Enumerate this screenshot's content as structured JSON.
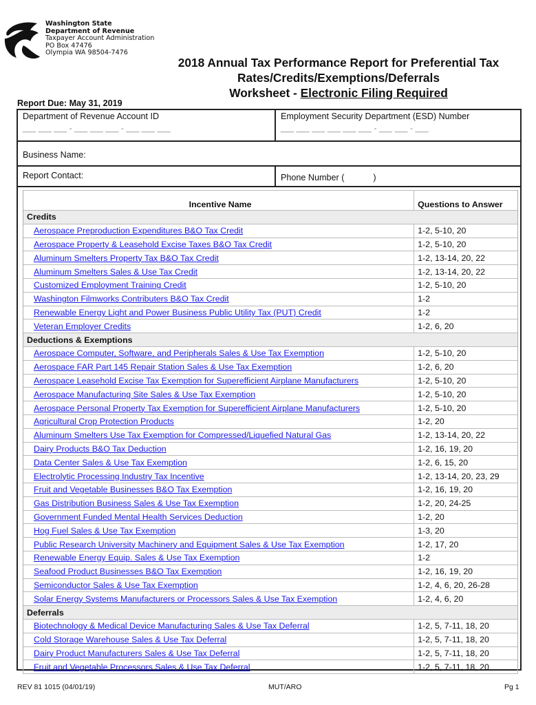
{
  "agency": {
    "line1": "Washington State",
    "line2": "Department of Revenue",
    "line3": "Taxpayer Account Administration",
    "line4": "PO Box 47476",
    "line5": "Olympia WA 98504-7476",
    "logo_icon": "dor-logo-icon"
  },
  "title": {
    "line1": "2018 Annual Tax Performance Report for Preferential Tax",
    "line2": "Rates/Credits/Exemptions/Deferrals",
    "line3_prefix": "Worksheet - ",
    "line3_underlined": "Electronic Filing Required"
  },
  "report_due": "Report Due: May 31, 2019",
  "form": {
    "account_id_label": "Department of Revenue Account ID",
    "account_id_blank": "___ ___ ___ - ___ ___ ___ - ___ ___ ___",
    "esd_label": "Employment Security Department (ESD) Number",
    "esd_blank": "___ ___ ___ ___ ___ ___ - ___ ___ - ___",
    "business_name_label": "Business Name:",
    "report_contact_label": "Report Contact:",
    "phone_label": "Phone Number (            )"
  },
  "table": {
    "headers": {
      "name": "Incentive Name",
      "questions": "Questions to Answer"
    },
    "sections": [
      {
        "title": "Credits",
        "rows": [
          {
            "name": "Aerospace Preproduction Expenditures B&O Tax Credit",
            "questions": "1-2, 5-10, 20"
          },
          {
            "name": "Aerospace Property & Leasehold Excise Taxes B&O Tax Credit",
            "questions": "1-2, 5-10, 20"
          },
          {
            "name": "Aluminum Smelters Property Tax B&O Tax Credit",
            "questions": "1-2, 13-14, 20, 22"
          },
          {
            "name": "Aluminum Smelters Sales & Use Tax Credit",
            "questions": "1-2, 13-14, 20, 22"
          },
          {
            "name": "Customized Employment Training Credit",
            "questions": "1-2, 5-10, 20"
          },
          {
            "name": "Washington Filmworks Contributers B&O Tax Credit",
            "questions": "1-2"
          },
          {
            "name": "Renewable Energy Light and Power Business Public Utility Tax (PUT) Credit",
            "questions": "1-2"
          },
          {
            "name": "Veteran Employer Credits",
            "questions": "1-2, 6, 20"
          }
        ]
      },
      {
        "title": "Deductions & Exemptions",
        "rows": [
          {
            "name": "Aerospace Computer, Software, and Peripherals Sales & Use Tax Exemption",
            "questions": "1-2, 5-10, 20"
          },
          {
            "name": "Aerospace FAR Part 145 Repair Station Sales & Use Tax Exemption",
            "questions": "1-2, 6, 20"
          },
          {
            "name": "Aerospace Leasehold Excise Tax Exemption for Superefficient Airplane Manufacturers",
            "questions": "1-2, 5-10, 20"
          },
          {
            "name": "Aerospace Manufacturing Site Sales & Use Tax Exemption",
            "questions": "1-2, 5-10, 20"
          },
          {
            "name": "Aerospace Personal Property Tax Exemption for Superefficient Airplane Manufacturers",
            "questions": "1-2, 5-10, 20"
          },
          {
            "name": "Agricultural Crop Protection Products",
            "questions": "1-2, 20"
          },
          {
            "name": "Aluminum Smelters Use Tax Exemption for Compressed/Liquefied Natural Gas",
            "questions": "1-2, 13-14, 20, 22"
          },
          {
            "name": "Dairy Products B&O Tax Deduction",
            "questions": "1-2, 16, 19, 20"
          },
          {
            "name": "Data Center Sales & Use Tax Exemption",
            "questions": "1-2, 6, 15, 20"
          },
          {
            "name": "Electrolytic Processing Industry Tax Incentive",
            "questions": "1-2, 13-14, 20, 23, 29"
          },
          {
            "name": "Fruit and Vegetable Businesses B&O Tax Exemption",
            "questions": "1-2, 16, 19, 20"
          },
          {
            "name": "Gas Distribution Business Sales & Use Tax Exemption",
            "questions": "1-2, 20, 24-25"
          },
          {
            "name": "Government Funded Mental Health Services Deduction",
            "questions": "1-2, 20"
          },
          {
            "name": "Hog Fuel Sales & Use Tax Exemption",
            "questions": "1-3, 20"
          },
          {
            "name": "Public Research University Machinery and Equipment Sales & Use Tax Exemption",
            "questions": "1-2, 17, 20"
          },
          {
            "name": "Renewable Energy Equip. Sales & Use Tax Exemption",
            "questions": "1-2"
          },
          {
            "name": "Seafood Product Businesses B&O Tax Exemption",
            "questions": "1-2, 16, 19, 20"
          },
          {
            "name": "Semiconductor Sales & Use Tax Exemption",
            "questions": "1-2, 4, 6, 20, 26-28"
          },
          {
            "name": "Solar Energy Systems Manufacturers or Processors Sales & Use Tax Exemption",
            "questions": "1-2, 4, 6, 20"
          }
        ]
      },
      {
        "title": "Deferrals",
        "rows": [
          {
            "name": "Biotechnology & Medical Device Manufacturing Sales & Use Tax Deferral",
            "questions": "1-2, 5, 7-11, 18, 20"
          },
          {
            "name": "Cold Storage Warehouse Sales & Use Tax Deferral",
            "questions": "1-2, 5, 7-11, 18, 20"
          },
          {
            "name": "Dairy Product Manufacturers Sales & Use Tax Deferral",
            "questions": "1-2, 5, 7-11, 18, 20"
          },
          {
            "name": "Fruit and Vegetable Processors Sales & Use Tax Deferral",
            "questions": "1-2, 5, 7-11, 18, 20"
          }
        ]
      }
    ]
  },
  "footer": {
    "form_number": "REV 81 1015 (04/01/19)",
    "center": "MUT/ARO",
    "page": "Pg 1"
  }
}
